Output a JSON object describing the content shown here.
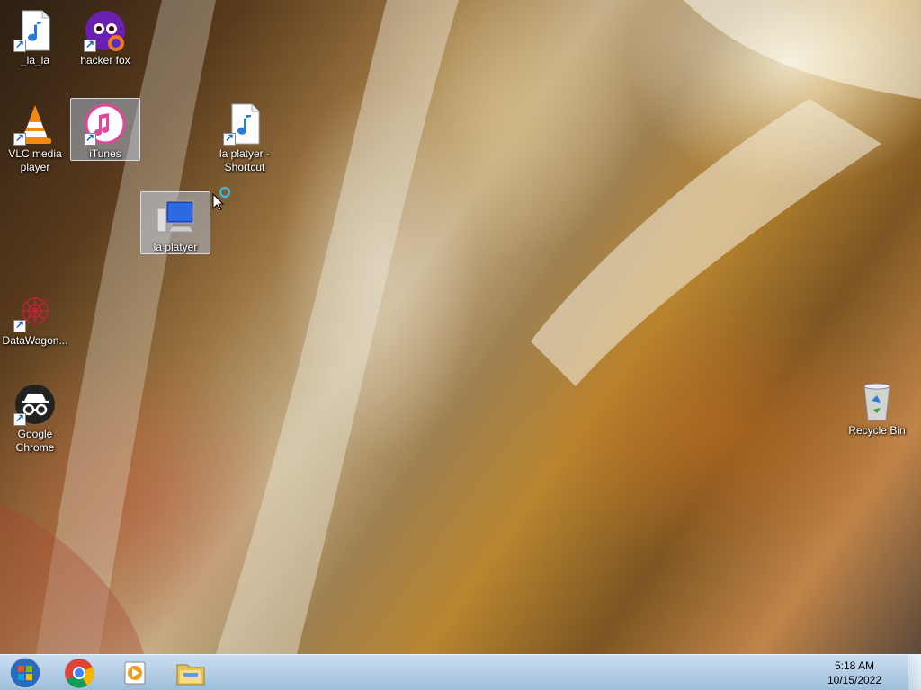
{
  "desktop": {
    "icons": [
      {
        "label": "_la_la",
        "icon": "audio-file-icon"
      },
      {
        "label": "hacker fox",
        "icon": "firefox-icon"
      },
      {
        "label": "VLC media player",
        "icon": "vlc-icon"
      },
      {
        "label": "iTunes",
        "icon": "itunes-icon"
      },
      {
        "label": "la platyer - Shortcut",
        "icon": "audio-file-icon"
      },
      {
        "label": "la platyer",
        "icon": "computer-icon"
      },
      {
        "label": "DataWagon...",
        "icon": "datawagon-icon"
      },
      {
        "label": "Google Chrome",
        "icon": "incognito-icon"
      },
      {
        "label": "Recycle Bin",
        "icon": "recycle-bin-icon"
      }
    ]
  },
  "taskbar": {
    "items": [
      {
        "icon": "start-orb-icon"
      },
      {
        "icon": "chrome-icon"
      },
      {
        "icon": "media-player-icon"
      },
      {
        "icon": "file-explorer-icon"
      }
    ],
    "clock": {
      "time": "5:18 AM",
      "date": "10/15/2022"
    }
  },
  "colors": {
    "selection": "#bcd2f0",
    "taskbar": "#a8c4e0",
    "accent_blue": "#1b5cc4"
  }
}
